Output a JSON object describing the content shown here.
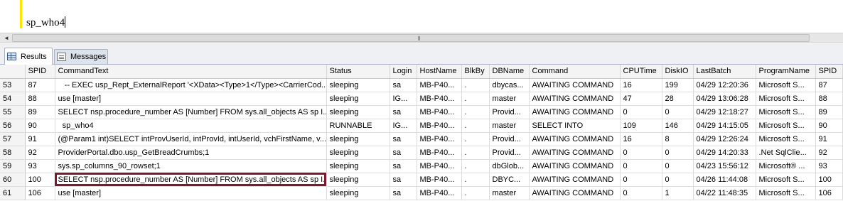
{
  "editor": {
    "query_text": "sp_who4"
  },
  "tabs": {
    "results_label": "Results",
    "messages_label": "Messages"
  },
  "scrollbar": {
    "grip_glyph": "⦀",
    "left_arrow": "◄"
  },
  "grid": {
    "columns": [
      "SPID",
      "CommandText",
      "Status",
      "Login",
      "HostName",
      "BlkBy",
      "DBName",
      "Command",
      "CPUTime",
      "DiskIO",
      "LastBatch",
      "ProgramName",
      "SPID"
    ],
    "rows": [
      {
        "rownum": "53",
        "cells": [
          "87",
          "   -- EXEC usp_Rept_ExternalReport '<XData><Type>1</Type><CarrierCod...",
          "sleeping",
          "sa",
          "MB-P40...",
          ".",
          "dbycas...",
          "AWAITING COMMAND",
          "16",
          "199",
          "04/29 12:20:36",
          "Microsoft S...",
          "87"
        ]
      },
      {
        "rownum": "54",
        "cells": [
          "88",
          "use [master]",
          "sleeping",
          "IG...",
          "MB-P40...",
          ".",
          "master",
          "AWAITING COMMAND",
          "47",
          "28",
          "04/29 13:06:28",
          "Microsoft S...",
          "88"
        ]
      },
      {
        "rownum": "55",
        "cells": [
          "89",
          "SELECT nsp.procedure_number AS [Number] FROM sys.all_objects AS sp I...",
          "sleeping",
          "sa",
          "MB-P40...",
          ".",
          "Provid...",
          "AWAITING COMMAND",
          "0",
          "0",
          "04/29 12:18:27",
          "Microsoft S...",
          "89"
        ]
      },
      {
        "rownum": "56",
        "cells": [
          "90",
          "  sp_who4",
          "RUNNABLE",
          "IG...",
          "MB-P40...",
          ".",
          "master",
          "SELECT INTO",
          "109",
          "146",
          "04/29 14:15:05",
          "Microsoft S...",
          "90"
        ]
      },
      {
        "rownum": "57",
        "cells": [
          "91",
          "(@Param1 int)SELECT intProvUserId, intProvId, intUserId, vchFirstName, v...",
          "sleeping",
          "sa",
          "MB-P40...",
          ".",
          "Provid...",
          "AWAITING COMMAND",
          "16",
          "8",
          "04/29 12:26:24",
          "Microsoft S...",
          "91"
        ]
      },
      {
        "rownum": "58",
        "cells": [
          "92",
          "ProviderPortal.dbo.usp_GetBreadCrumbs;1",
          "sleeping",
          "sa",
          "MB-P40...",
          ".",
          "Provid...",
          "AWAITING COMMAND",
          "0",
          "0",
          "04/29 14:20:33",
          ".Net SqlClie...",
          "92"
        ]
      },
      {
        "rownum": "59",
        "cells": [
          "93",
          "sys.sp_columns_90_rowset;1",
          "sleeping",
          "sa",
          "MB-P40...",
          ".",
          "dbGlob...",
          "AWAITING COMMAND",
          "0",
          "0",
          "04/23 15:56:12",
          "Microsoft® ...",
          "93"
        ]
      },
      {
        "rownum": "60",
        "cells": [
          "100",
          "SELECT nsp.procedure_number AS [Number] FROM sys.all_objects AS sp I...",
          "sleeping",
          "sa",
          "MB-P40...",
          ".",
          "DBYC...",
          "AWAITING COMMAND",
          "0",
          "0",
          "04/26 11:44:08",
          "Microsoft S...",
          "100"
        ],
        "highlight": true
      },
      {
        "rownum": "61",
        "cells": [
          "106",
          "use [master]",
          "sleeping",
          "sa",
          "MB-P40...",
          ".",
          "master",
          "AWAITING COMMAND",
          "0",
          "1",
          "04/22 11:48:35",
          "Microsoft S...",
          "106"
        ]
      }
    ]
  },
  "colors": {
    "highlight_border": "#7b1a2e",
    "editor_margin": "#ffe500"
  }
}
